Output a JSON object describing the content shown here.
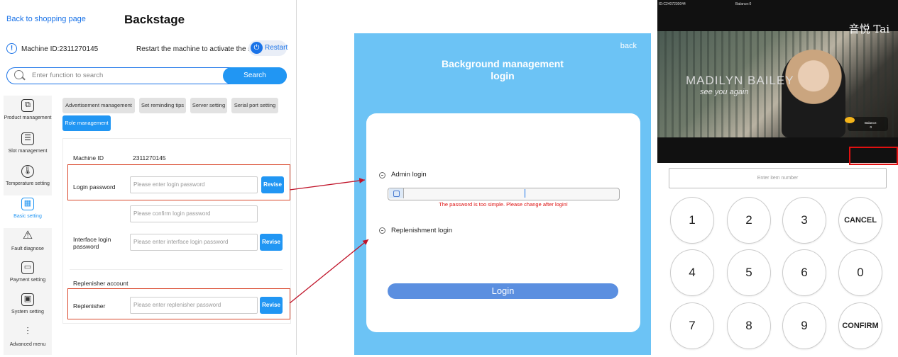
{
  "backstage": {
    "back_link": "Back to shopping page",
    "title": "Backstage",
    "machine_id_label": "Machine ID:2311270145",
    "restart_note": "Restart the machine to activate the settings",
    "restart_label": "Restart",
    "search_placeholder": "Enter function to search",
    "search_button": "Search",
    "sidebar": [
      {
        "label": "Product management",
        "icon": "box-icon"
      },
      {
        "label": "Slot management",
        "icon": "tray-icon"
      },
      {
        "label": "Temperature setting",
        "icon": "thermometer-icon"
      },
      {
        "label": "Basic setting",
        "icon": "grid-icon"
      },
      {
        "label": "Fault diagnose",
        "icon": "warning-icon"
      },
      {
        "label": "Payment setting",
        "icon": "wallet-icon"
      },
      {
        "label": "System setting",
        "icon": "chip-icon"
      },
      {
        "label": "Advanced menu",
        "icon": "sliders-icon"
      }
    ],
    "tabs": [
      "Advertisement management",
      "Set reminding tips",
      "Server setting",
      "Serial port setting",
      "Role management"
    ],
    "form": {
      "machine_id_label": "Machine ID",
      "machine_id_value": "2311270145",
      "login_password_label": "Login password",
      "login_password_placeholder": "Please enter login password",
      "confirm_placeholder": "Please confirm login password",
      "interface_label_1": "Interface login",
      "interface_label_2": "password",
      "interface_placeholder": "Please enter interface login password",
      "replenisher_account_label": "Replenisher account",
      "replenisher_label": "Replenisher",
      "replenisher_placeholder": "Please enter replenisher password",
      "revise": "Revise"
    }
  },
  "login": {
    "back": "back",
    "title_1": "Background management",
    "title_2": "login",
    "admin_login": "Admin login",
    "error": "The password is too simple. Please change after login!",
    "replenishment_login": "Replenishment login",
    "login_button": "Login"
  },
  "keypad": {
    "id_text": "ID:C2407230044",
    "balance_top": "Balance:0",
    "brand": "音悦 Tai",
    "artist": "MADILYN BAILEY",
    "song": "see you again",
    "balance_bubble_label": "Balance:",
    "balance_bubble_value": "0",
    "item_placeholder": "Enter item number",
    "keys": [
      "1",
      "2",
      "3",
      "CANCEL",
      "4",
      "5",
      "6",
      "0",
      "7",
      "8",
      "9",
      "CONFIRM"
    ]
  },
  "colors": {
    "accent": "#2196f3",
    "highlight": "#d9472b",
    "panel_bg": "#6cc3f5",
    "arrow": "#c0142a"
  }
}
